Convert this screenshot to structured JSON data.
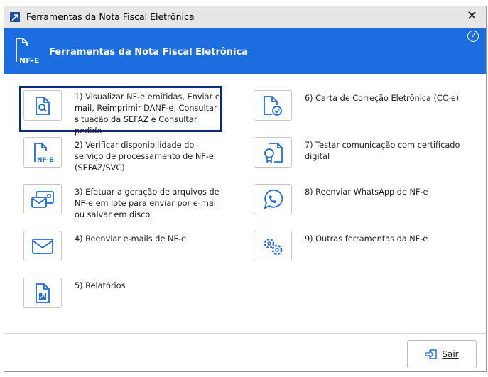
{
  "window": {
    "title": "Ferramentas da Nota Fiscal Eletrônica",
    "close": "✕"
  },
  "header": {
    "title": "Ferramentas da Nota Fiscal Eletrônica",
    "help": "?",
    "logo_text": "NF-E"
  },
  "accent": "#1c6ddf",
  "tools": [
    {
      "label": "1) Visualizar NF-e emitidas, Enviar e-mail, Reimprimir DANF-e, Consultar situação da SEFAZ e Consultar pedido",
      "icon": "document-search-icon"
    },
    {
      "label": "2) Verificar disponibilidade do serviço de processamento de NF-e (SEFAZ/SVC)",
      "icon": "nfe-document-icon"
    },
    {
      "label": "3) Efetuar a geração de arquivos de NF-e em lote para enviar por e-mail ou salvar em disco",
      "icon": "batch-mail-icon"
    },
    {
      "label": "4) Reenviar e-mails de NF-e",
      "icon": "envelope-icon"
    },
    {
      "label": "5) Relatórios",
      "icon": "report-icon"
    },
    {
      "label": "6) Carta de Correção Eletrônica (CC-e)",
      "icon": "document-check-icon"
    },
    {
      "label": "7) Testar comunicação com certificado digital",
      "icon": "certificate-icon"
    },
    {
      "label": "8) Reenviar WhatsApp de NF-e",
      "icon": "whatsapp-icon"
    },
    {
      "label": "9) Outras ferramentas da NF-e",
      "icon": "gears-icon"
    }
  ],
  "footer": {
    "exit_label": "Sair"
  }
}
